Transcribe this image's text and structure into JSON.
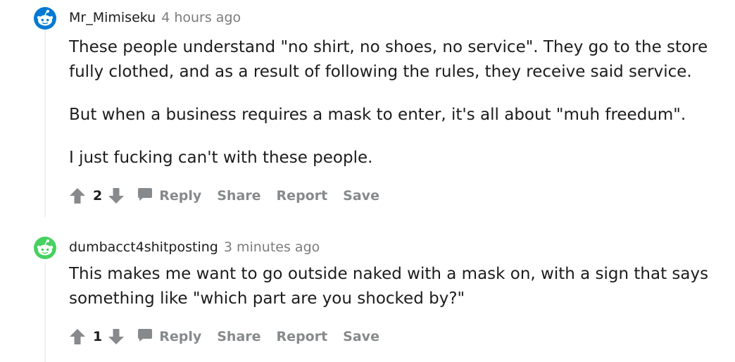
{
  "comments": [
    {
      "username": "Mr_Mimiseku",
      "timestamp": "4 hours ago",
      "paragraphs": [
        "These people understand \"no shirt, no shoes, no service\". They go to the store fully clothed, and as a result of following the rules, they receive said service.",
        "But when a business requires a mask to enter, it's all about \"muh freedum\".",
        "I just fucking can't with these people."
      ],
      "score": "2",
      "avatar_color": "#0079d3"
    },
    {
      "username": "dumbacct4shitposting",
      "timestamp": "3 minutes ago",
      "paragraphs": [
        "This makes me want to go outside naked with a mask on, with a sign that says something like \"which part are you shocked by?\""
      ],
      "score": "1",
      "avatar_color": "#46d160"
    }
  ],
  "actions": {
    "reply": "Reply",
    "share": "Share",
    "report": "Report",
    "save": "Save"
  }
}
